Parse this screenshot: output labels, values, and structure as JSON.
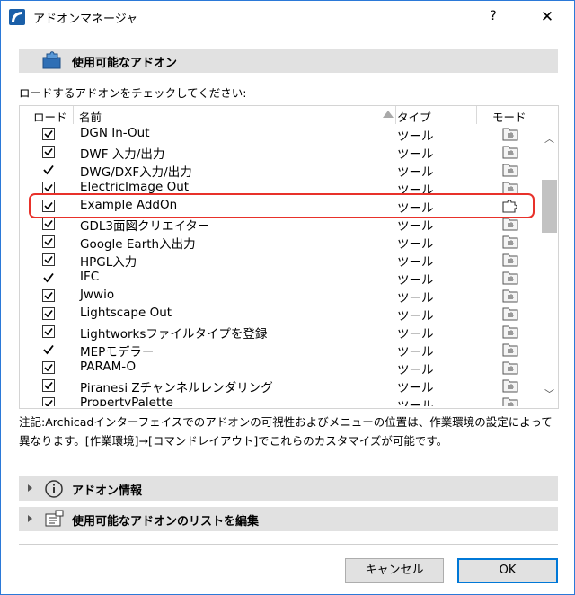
{
  "window": {
    "title": "アドオンマネージャ",
    "help": "?",
    "close": "✕"
  },
  "available_section": {
    "label": "使用可能なアドオン"
  },
  "instruction": "ロードするアドオンをチェックしてください:",
  "table": {
    "headers": {
      "load": "ロード",
      "name": "名前",
      "type": "タイプ",
      "mode": "モード"
    },
    "rows": [
      {
        "name": "DGN In-Out",
        "type": "ツール",
        "check": "box",
        "mode": "folder",
        "partial": false
      },
      {
        "name": "DWF 入力/出力",
        "type": "ツール",
        "check": "box",
        "mode": "folder",
        "partial": false
      },
      {
        "name": "DWG/DXF入力/出力",
        "type": "ツール",
        "check": "tick",
        "mode": "folder",
        "partial": false
      },
      {
        "name": "ElectricImage Out",
        "type": "ツール",
        "check": "box",
        "mode": "folder",
        "partial": false
      },
      {
        "name": "Example AddOn",
        "type": "ツール",
        "check": "box",
        "mode": "puzzle",
        "partial": false
      },
      {
        "name": "GDL3面図クリエイター",
        "type": "ツール",
        "check": "box",
        "mode": "folder",
        "partial": false
      },
      {
        "name": "Google Earth入出力",
        "type": "ツール",
        "check": "box",
        "mode": "folder",
        "partial": false
      },
      {
        "name": "HPGL入力",
        "type": "ツール",
        "check": "box",
        "mode": "folder",
        "partial": false
      },
      {
        "name": "IFC",
        "type": "ツール",
        "check": "tick",
        "mode": "folder",
        "partial": false
      },
      {
        "name": "Jwwio",
        "type": "ツール",
        "check": "box",
        "mode": "folder",
        "partial": false
      },
      {
        "name": "Lightscape Out",
        "type": "ツール",
        "check": "box",
        "mode": "folder",
        "partial": false
      },
      {
        "name": "Lightworksファイルタイプを登録",
        "type": "ツール",
        "check": "box",
        "mode": "folder",
        "partial": false
      },
      {
        "name": "MEPモデラー",
        "type": "ツール",
        "check": "tick",
        "mode": "folder",
        "partial": false
      },
      {
        "name": "PARAM-O",
        "type": "ツール",
        "check": "box",
        "mode": "folder",
        "partial": false
      },
      {
        "name": "Piranesi Zチャンネルレンダリング",
        "type": "ツール",
        "check": "box",
        "mode": "folder",
        "partial": false
      },
      {
        "name": "PropertyPalette",
        "type": "ツール",
        "check": "box",
        "mode": "folder",
        "partial": true
      }
    ],
    "highlighted_row": "Example AddOn"
  },
  "note": {
    "line1": "注記:Archicadインターフェイスでのアドオンの可視性およびメニューの位置は、作業環境の設定によって",
    "line2": "異なります。[作業環境]→[コマンドレイアウト]でこれらのカスタマイズが可能です。"
  },
  "info_section": {
    "label": "アドオン情報"
  },
  "edit_section": {
    "label": "使用可能なアドオンのリストを編集"
  },
  "buttons": {
    "cancel": "キャンセル",
    "ok": "OK"
  },
  "colors": {
    "highlight_border": "#e8312a",
    "ok_border": "#0078d7",
    "section_bg": "#e1e1e1"
  }
}
